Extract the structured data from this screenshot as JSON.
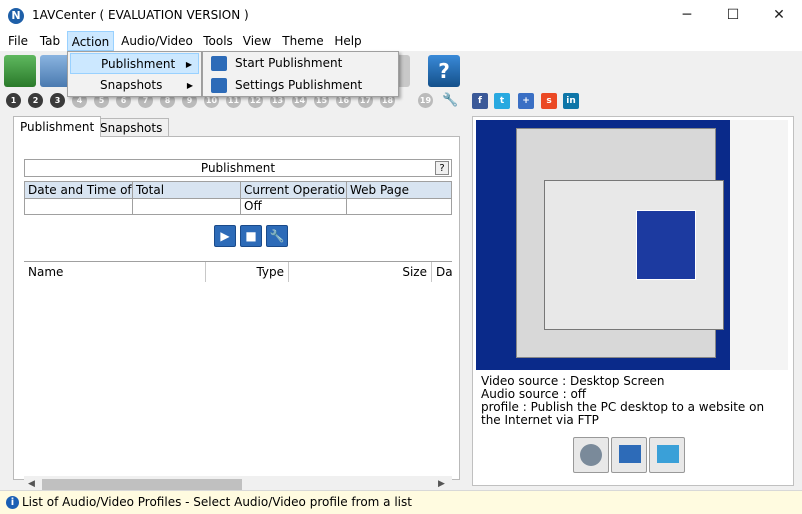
{
  "window": {
    "title": "1AVCenter ( EVALUATION VERSION )",
    "minimize": "─",
    "maximize": "☐",
    "close": "✕"
  },
  "menu": [
    "File",
    "Tab",
    "Action",
    "Audio/Video",
    "Tools",
    "View",
    "Theme",
    "Help"
  ],
  "numbered_buttons": [
    "1",
    "2",
    "3",
    "4",
    "5",
    "6",
    "7",
    "8",
    "9",
    "10",
    "11",
    "12",
    "13",
    "14",
    "15",
    "16",
    "17",
    "18",
    "19"
  ],
  "left": {
    "tabs": [
      "Publishment",
      "Snapshots"
    ],
    "section_title": "Publishment",
    "help": "?",
    "info_columns": [
      "Date and Time of",
      "Total",
      "Current Operation",
      "Web Page"
    ],
    "info_row": [
      "",
      "",
      "Off",
      ""
    ],
    "controls": [
      "▶",
      "■",
      "🔧"
    ],
    "file_columns": [
      "Name",
      "Type",
      "Size",
      "Da"
    ]
  },
  "right": {
    "video_source": "Video source : Desktop Screen",
    "audio_source": "Audio source : off",
    "profile": "profile : Publish the PC desktop to a website on the Internet via FTP"
  },
  "status": {
    "text": "List of Audio/Video Profiles - Select Audio/Video profile from a list"
  },
  "action_menu": {
    "items": [
      "Publishment",
      "Snapshots"
    ]
  },
  "publishment_submenu": {
    "items": [
      "Start Publishment",
      "Settings Publishment"
    ]
  },
  "colors": {
    "accent": "#cce8ff",
    "status_bg": "#fffbe0",
    "header_bg": "#d8e4f1",
    "preview_bg": "#0a2a8a"
  }
}
